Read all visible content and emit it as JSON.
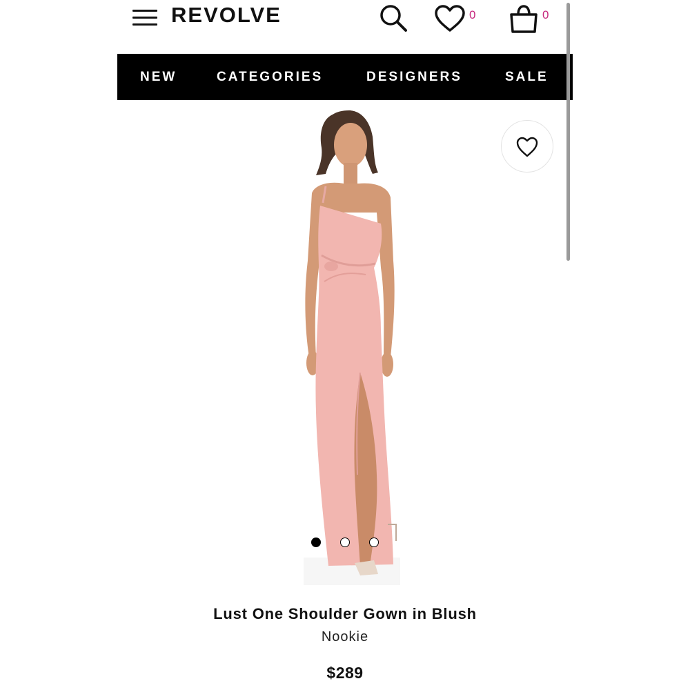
{
  "header": {
    "brand": "REVOLVE",
    "wishlist_count": "0",
    "bag_count": "0"
  },
  "nav": {
    "items": [
      "NEW",
      "CATEGORIES",
      "DESIGNERS",
      "SALE"
    ]
  },
  "product": {
    "name": "Lust One Shoulder Gown in Blush",
    "designer": "Nookie",
    "price": "$289",
    "color": "#f2b6b0",
    "image_count": 3,
    "active_image": 1
  },
  "colors": {
    "accent_badge": "#c6287d",
    "nav_background": "#000000"
  },
  "icons": [
    "menu-icon",
    "search-icon",
    "heart-icon",
    "shopping-bag-icon",
    "heart-outline-icon"
  ]
}
